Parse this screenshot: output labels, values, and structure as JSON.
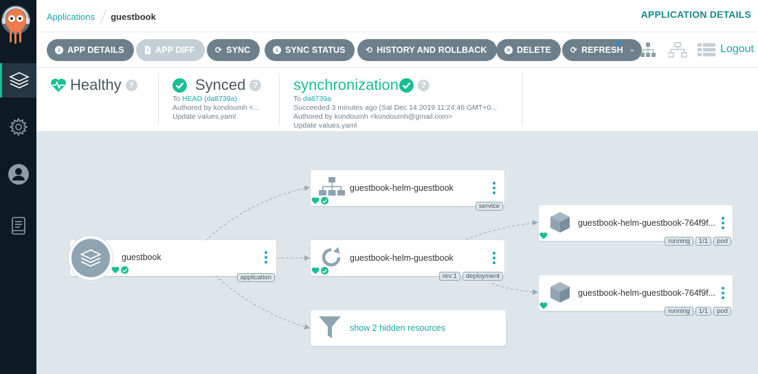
{
  "breadcrumb": {
    "root": "Applications",
    "current": "guestbook"
  },
  "page_title": "APPLICATION DETAILS",
  "toolbar": {
    "app_details": "APP DETAILS",
    "app_diff": "APP DIFF",
    "sync": "SYNC",
    "sync_status": "SYNC STATUS",
    "history": "HISTORY AND ROLLBACK",
    "delete": "DELETE",
    "refresh": "REFRESH",
    "logout": "Logout"
  },
  "health": {
    "title": "Healthy"
  },
  "sync_panel": {
    "title": "Synced",
    "to_prefix": "To",
    "revision": "HEAD (da8739a)",
    "author": "Authored by kondoumh <...",
    "message": "Update values.yaml"
  },
  "operation": {
    "title": "synchronization",
    "to_prefix": "To",
    "revision": "da8739a",
    "time": "Succeeded 3 minutes ago (Sat Dec 14 2019 11:24:46 GMT+0...",
    "author": "Authored by kondoumh <kondoumh@gmail.com>",
    "message": "Update values.yaml"
  },
  "nodes": {
    "app": {
      "name": "guestbook",
      "kind": "application"
    },
    "service": {
      "name": "guestbook-helm-guestbook",
      "kind": "service"
    },
    "deployment": {
      "name": "guestbook-helm-guestbook",
      "rev": "rev:1",
      "kind": "deployment"
    },
    "hidden": {
      "label": "show 2 hidden resources"
    },
    "pod1": {
      "name": "guestbook-helm-guestbook-764f9f...",
      "status": "running",
      "ready": "1/1",
      "kind": "pod"
    },
    "pod2": {
      "name": "guestbook-helm-guestbook-764f9f...",
      "status": "running",
      "ready": "1/1",
      "kind": "pod"
    }
  },
  "colors": {
    "accent": "#1aa6ac",
    "healthy": "#18be94",
    "button": "#6d7f8b",
    "sidebar": "#0e1a23",
    "canvas": "#dee6eb"
  }
}
